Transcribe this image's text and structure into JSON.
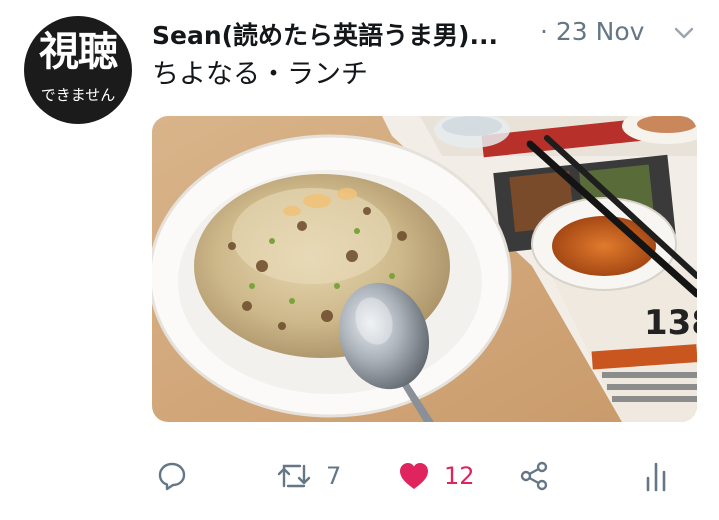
{
  "tweet": {
    "avatar": {
      "line1": "視聴",
      "line2": "できません"
    },
    "display_name": "Sean(読めたら英語うま男)...",
    "separator": "·",
    "date": "23 Nov",
    "text": "ちよなる・ランチ",
    "media": {
      "icon": "photo",
      "description_visible": false
    },
    "actions": {
      "reply": {
        "icon": "reply-icon"
      },
      "retweet": {
        "icon": "retweet-icon",
        "count": "7"
      },
      "like": {
        "icon": "heart-icon",
        "count": "12",
        "liked": true
      },
      "share": {
        "icon": "share-icon"
      },
      "analytics": {
        "icon": "analytics-icon"
      }
    },
    "colors": {
      "like_active": "#e0245e",
      "secondary_text": "#657786",
      "primary_text": "#14171a"
    }
  }
}
